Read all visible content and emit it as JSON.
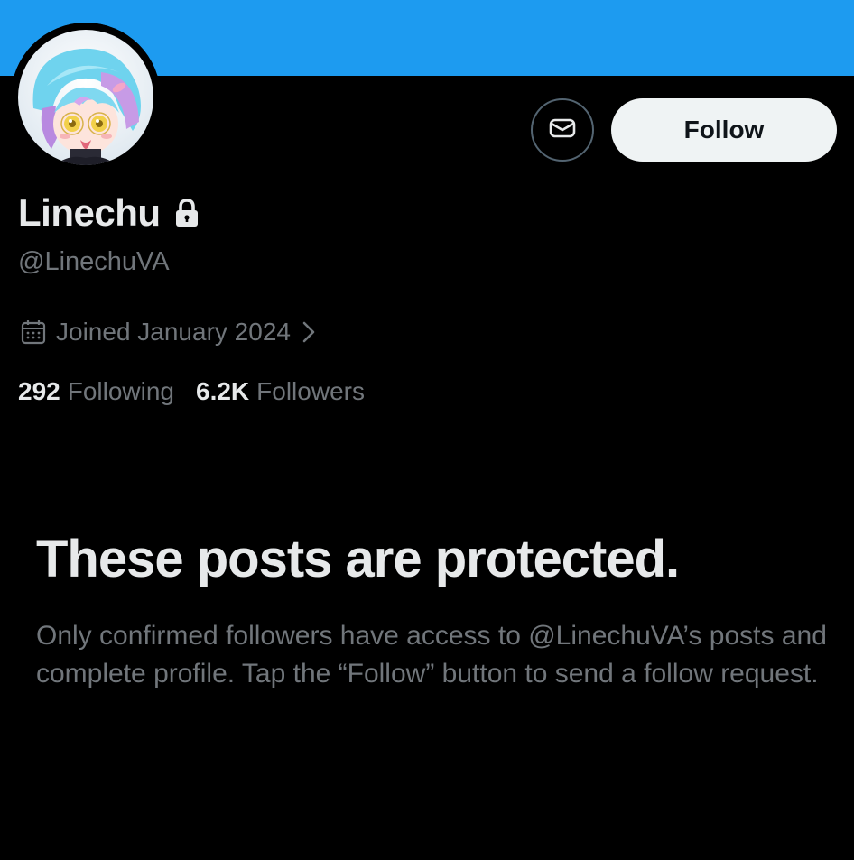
{
  "profile": {
    "display_name": "Linechu",
    "handle": "@LinechuVA",
    "joined": "Joined January 2024",
    "following_count": "292",
    "following_label": "Following",
    "followers_count": "6.2K",
    "followers_label": "Followers"
  },
  "actions": {
    "follow_label": "Follow",
    "dm_icon": "envelope-icon"
  },
  "protected": {
    "title": "These posts are protected.",
    "body": "Only confirmed followers have access to @LinechuVA’s posts and complete profile. Tap the “Follow” button to send a follow request."
  },
  "colors": {
    "banner": "#1d9bf0",
    "background": "#000000",
    "primary_text": "#e7e9ea",
    "secondary_text": "#71767b",
    "follow_button_bg": "#eff3f4"
  },
  "icons": {
    "lock": "lock-icon",
    "calendar": "calendar-icon",
    "chevron": "chevron-right-icon"
  }
}
